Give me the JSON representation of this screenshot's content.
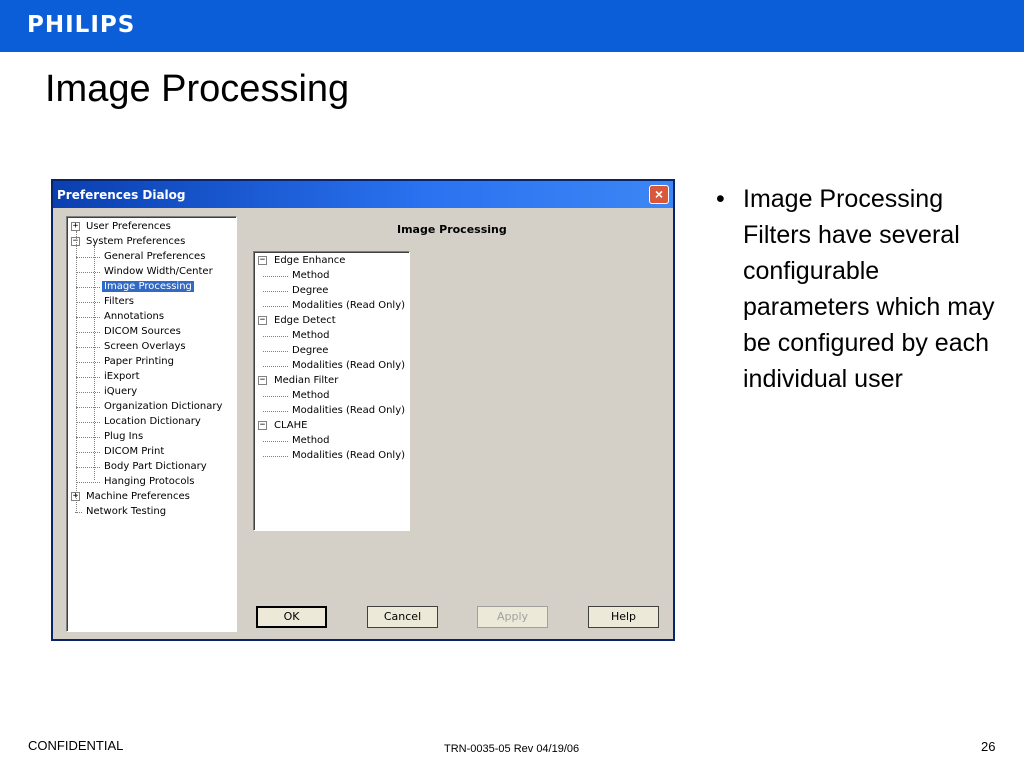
{
  "header": {
    "logo": "PHILIPS",
    "brand_color": "#0b5ed7"
  },
  "slide": {
    "title": "Image Processing"
  },
  "dialog": {
    "title": "Preferences Dialog",
    "close_icon": "close-icon",
    "panel_heading": "Image Processing",
    "tree": [
      {
        "label": "User Preferences",
        "expander": "+"
      },
      {
        "label": "System Preferences",
        "expander": "−"
      },
      {
        "label": "General Preferences"
      },
      {
        "label": "Window Width/Center"
      },
      {
        "label": "Image Processing",
        "selected": true
      },
      {
        "label": "Filters"
      },
      {
        "label": "Annotations"
      },
      {
        "label": "DICOM Sources"
      },
      {
        "label": "Screen Overlays"
      },
      {
        "label": "Paper Printing"
      },
      {
        "label": "iExport"
      },
      {
        "label": "iQuery"
      },
      {
        "label": "Organization Dictionary"
      },
      {
        "label": "Location Dictionary"
      },
      {
        "label": "Plug Ins"
      },
      {
        "label": "DICOM Print"
      },
      {
        "label": "Body Part Dictionary"
      },
      {
        "label": "Hanging Protocols"
      },
      {
        "label": "Machine Preferences",
        "expander": "+"
      },
      {
        "label": "Network Testing"
      }
    ],
    "filters": [
      {
        "label": "Edge Enhance",
        "expander": "−"
      },
      {
        "label": "Method"
      },
      {
        "label": "Degree"
      },
      {
        "label": "Modalities (Read Only)"
      },
      {
        "label": "Edge Detect",
        "expander": "−"
      },
      {
        "label": "Method"
      },
      {
        "label": "Degree"
      },
      {
        "label": "Modalities (Read Only)"
      },
      {
        "label": "Median Filter",
        "expander": "−"
      },
      {
        "label": "Method"
      },
      {
        "label": "Modalities (Read Only)"
      },
      {
        "label": "CLAHE",
        "expander": "−"
      },
      {
        "label": "Method"
      },
      {
        "label": "Modalities (Read Only)"
      }
    ],
    "buttons": {
      "ok": "OK",
      "cancel": "Cancel",
      "apply": "Apply",
      "help": "Help"
    }
  },
  "bullets": [
    "Image Processing Filters have several configurable parameters which may be configured by each individual user"
  ],
  "footer": {
    "left": "CONFIDENTIAL",
    "center": "TRN-0035-05 Rev 04/19/06",
    "page": "26"
  }
}
